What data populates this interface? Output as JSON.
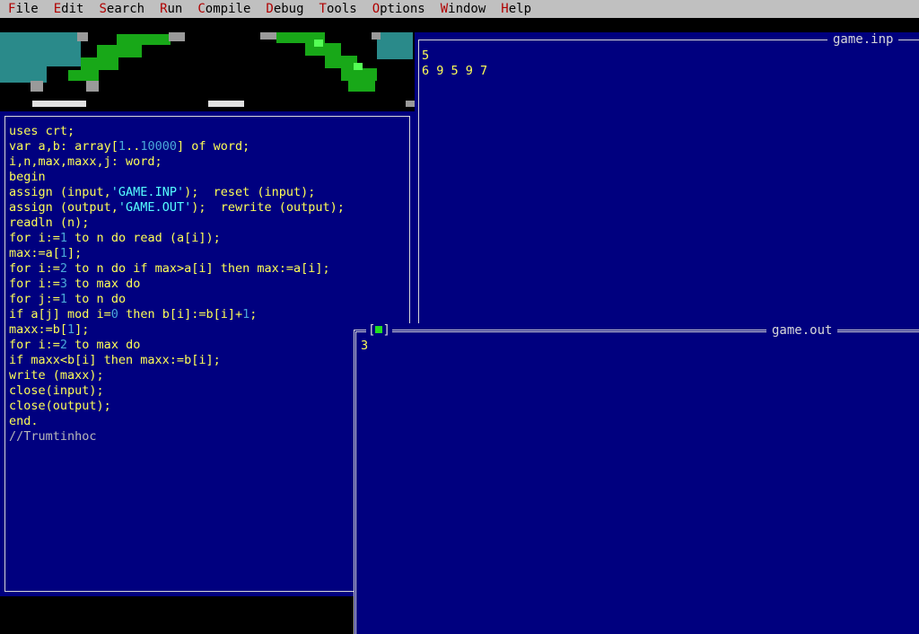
{
  "menu": [
    {
      "hot": "F",
      "rest": "ile"
    },
    {
      "hot": "E",
      "rest": "dit"
    },
    {
      "hot": "S",
      "rest": "earch"
    },
    {
      "hot": "R",
      "rest": "un"
    },
    {
      "hot": "C",
      "rest": "ompile"
    },
    {
      "hot": "D",
      "rest": "ebug"
    },
    {
      "hot": "T",
      "rest": "ools"
    },
    {
      "hot": "O",
      "rest": "ptions"
    },
    {
      "hot": "W",
      "rest": "indow"
    },
    {
      "hot": "H",
      "rest": "elp"
    }
  ],
  "editor": {
    "lines": [
      "uses crt;",
      "var a,b: array[1..10000] of word;",
      "i,n,max,maxx,j: word;",
      "begin",
      "assign (input,'GAME.INP');  reset (input);",
      "assign (output,'GAME.OUT');  rewrite (output);",
      "readln (n);",
      "for i:=1 to n do read (a[i]);",
      "max:=a[1];",
      "for i:=2 to n do if max>a[i] then max:=a[i];",
      "for i:=3 to max do",
      "for j:=1 to n do",
      "if a[j] mod i=0 then b[i]:=b[i]+1;",
      "maxx:=b[1];",
      "for i:=2 to max do",
      "if maxx<b[i] then maxx:=b[i];",
      "write (maxx);",
      "close(input);",
      "close(output);",
      "end.",
      "//Trumtinhoc"
    ]
  },
  "inp_window": {
    "title": "game.inp",
    "lines": [
      "5",
      "6 9 5 9 7"
    ]
  },
  "out_window": {
    "title": "game.out",
    "close_left": "[",
    "close_right": "]",
    "lines": [
      "3"
    ]
  },
  "colors": {
    "window_bg": "#00007f",
    "text": "#ffff55",
    "number": "#4aa8d8",
    "string": "#55ffff",
    "menu_bg": "#c0c0c0",
    "hotkey": "#b00000"
  }
}
